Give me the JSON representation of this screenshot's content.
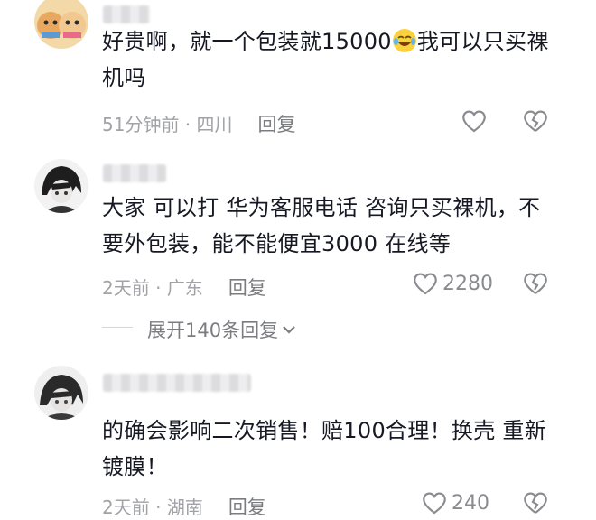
{
  "comments": [
    {
      "username": "",
      "text_before_emoji": "好贵啊，就一个包装就15000",
      "emoji": "crying-laughing-emoji",
      "text_after_emoji": "我可以只买裸机吗",
      "time": "51分钟前",
      "location": "四川",
      "reply_label": "回复",
      "like_count": "",
      "avatar": "cats-avatar"
    },
    {
      "username": "",
      "text": "大家 可以打 华为客服电话 咨询只买裸机，不要外包装，能不能便宜3000 在线等",
      "time": "2天前",
      "location": "广东",
      "reply_label": "回复",
      "like_count": "2280",
      "avatar": "anime-avatar"
    },
    {
      "username": "",
      "text": "的确会影响二次销售！赔100合理！换壳 重新镀膜！",
      "time": "2天前",
      "location": "湖南",
      "reply_label": "回复",
      "like_count": "240",
      "avatar": "anime-avatar-2"
    }
  ],
  "expand_replies": "展开140条回复",
  "separator": " · ",
  "colors": {
    "text": "#161823",
    "meta": "#a2a3a7",
    "icon": "#8a8b8f"
  }
}
